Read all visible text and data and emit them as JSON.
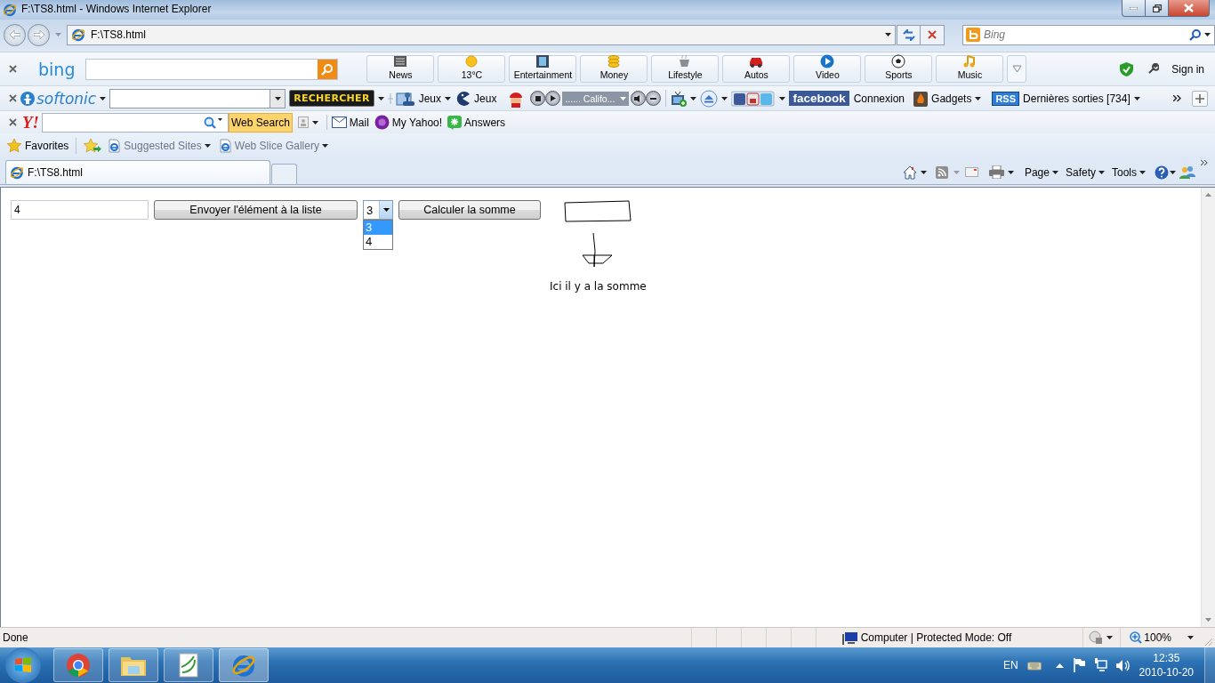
{
  "window": {
    "title": "F:\\TS8.html - Windows Internet Explorer"
  },
  "address_bar": {
    "url": "F:\\TS8.html",
    "search_placeholder": "Bing"
  },
  "bing_toolbar": {
    "logo": "bing",
    "buttons": [
      {
        "label": "News"
      },
      {
        "label": "13°C"
      },
      {
        "label": "Entertainment"
      },
      {
        "label": "Money"
      },
      {
        "label": "Lifestyle"
      },
      {
        "label": "Autos"
      },
      {
        "label": "Video"
      },
      {
        "label": "Sports"
      },
      {
        "label": "Music"
      }
    ],
    "sign_in": "Sign in"
  },
  "softonic_toolbar": {
    "logo": "softonic",
    "search_button": "RECHERCHER",
    "games": [
      "Jeux",
      "Jeux"
    ],
    "radio_station": "...... Califo...",
    "facebook_logo": "facebook",
    "facebook_link": "Connexion",
    "gadgets": "Gadgets",
    "rss_badge": "RSS",
    "news_feed": "Dernières sorties [734]"
  },
  "yahoo_toolbar": {
    "logo": "Y!",
    "search_button": "Web Search",
    "links": [
      "Mail",
      "My Yahoo!",
      "Answers"
    ]
  },
  "favorites_bar": {
    "favorites": "Favorites",
    "links": [
      "Suggested Sites",
      "Web Slice Gallery"
    ]
  },
  "tabs": [
    {
      "label": "F:\\TS8.html",
      "selected": true
    }
  ],
  "command_bar": [
    "Page",
    "Safety",
    "Tools"
  ],
  "page": {
    "text_input": "4",
    "send_button": "Envoyer l'élément à la liste",
    "select": {
      "value": "3",
      "options": [
        {
          "label": "3",
          "selected": true
        },
        {
          "label": "4",
          "selected": false
        }
      ]
    },
    "sum_button": "Calculer la somme",
    "annotation": "Ici il y a la somme"
  },
  "status_bar": {
    "status": "Done",
    "zone": "Computer | Protected Mode: Off",
    "zoom": "100%"
  },
  "taskbar": {
    "language": "EN",
    "time": "12:35",
    "date": "2010-10-20"
  }
}
